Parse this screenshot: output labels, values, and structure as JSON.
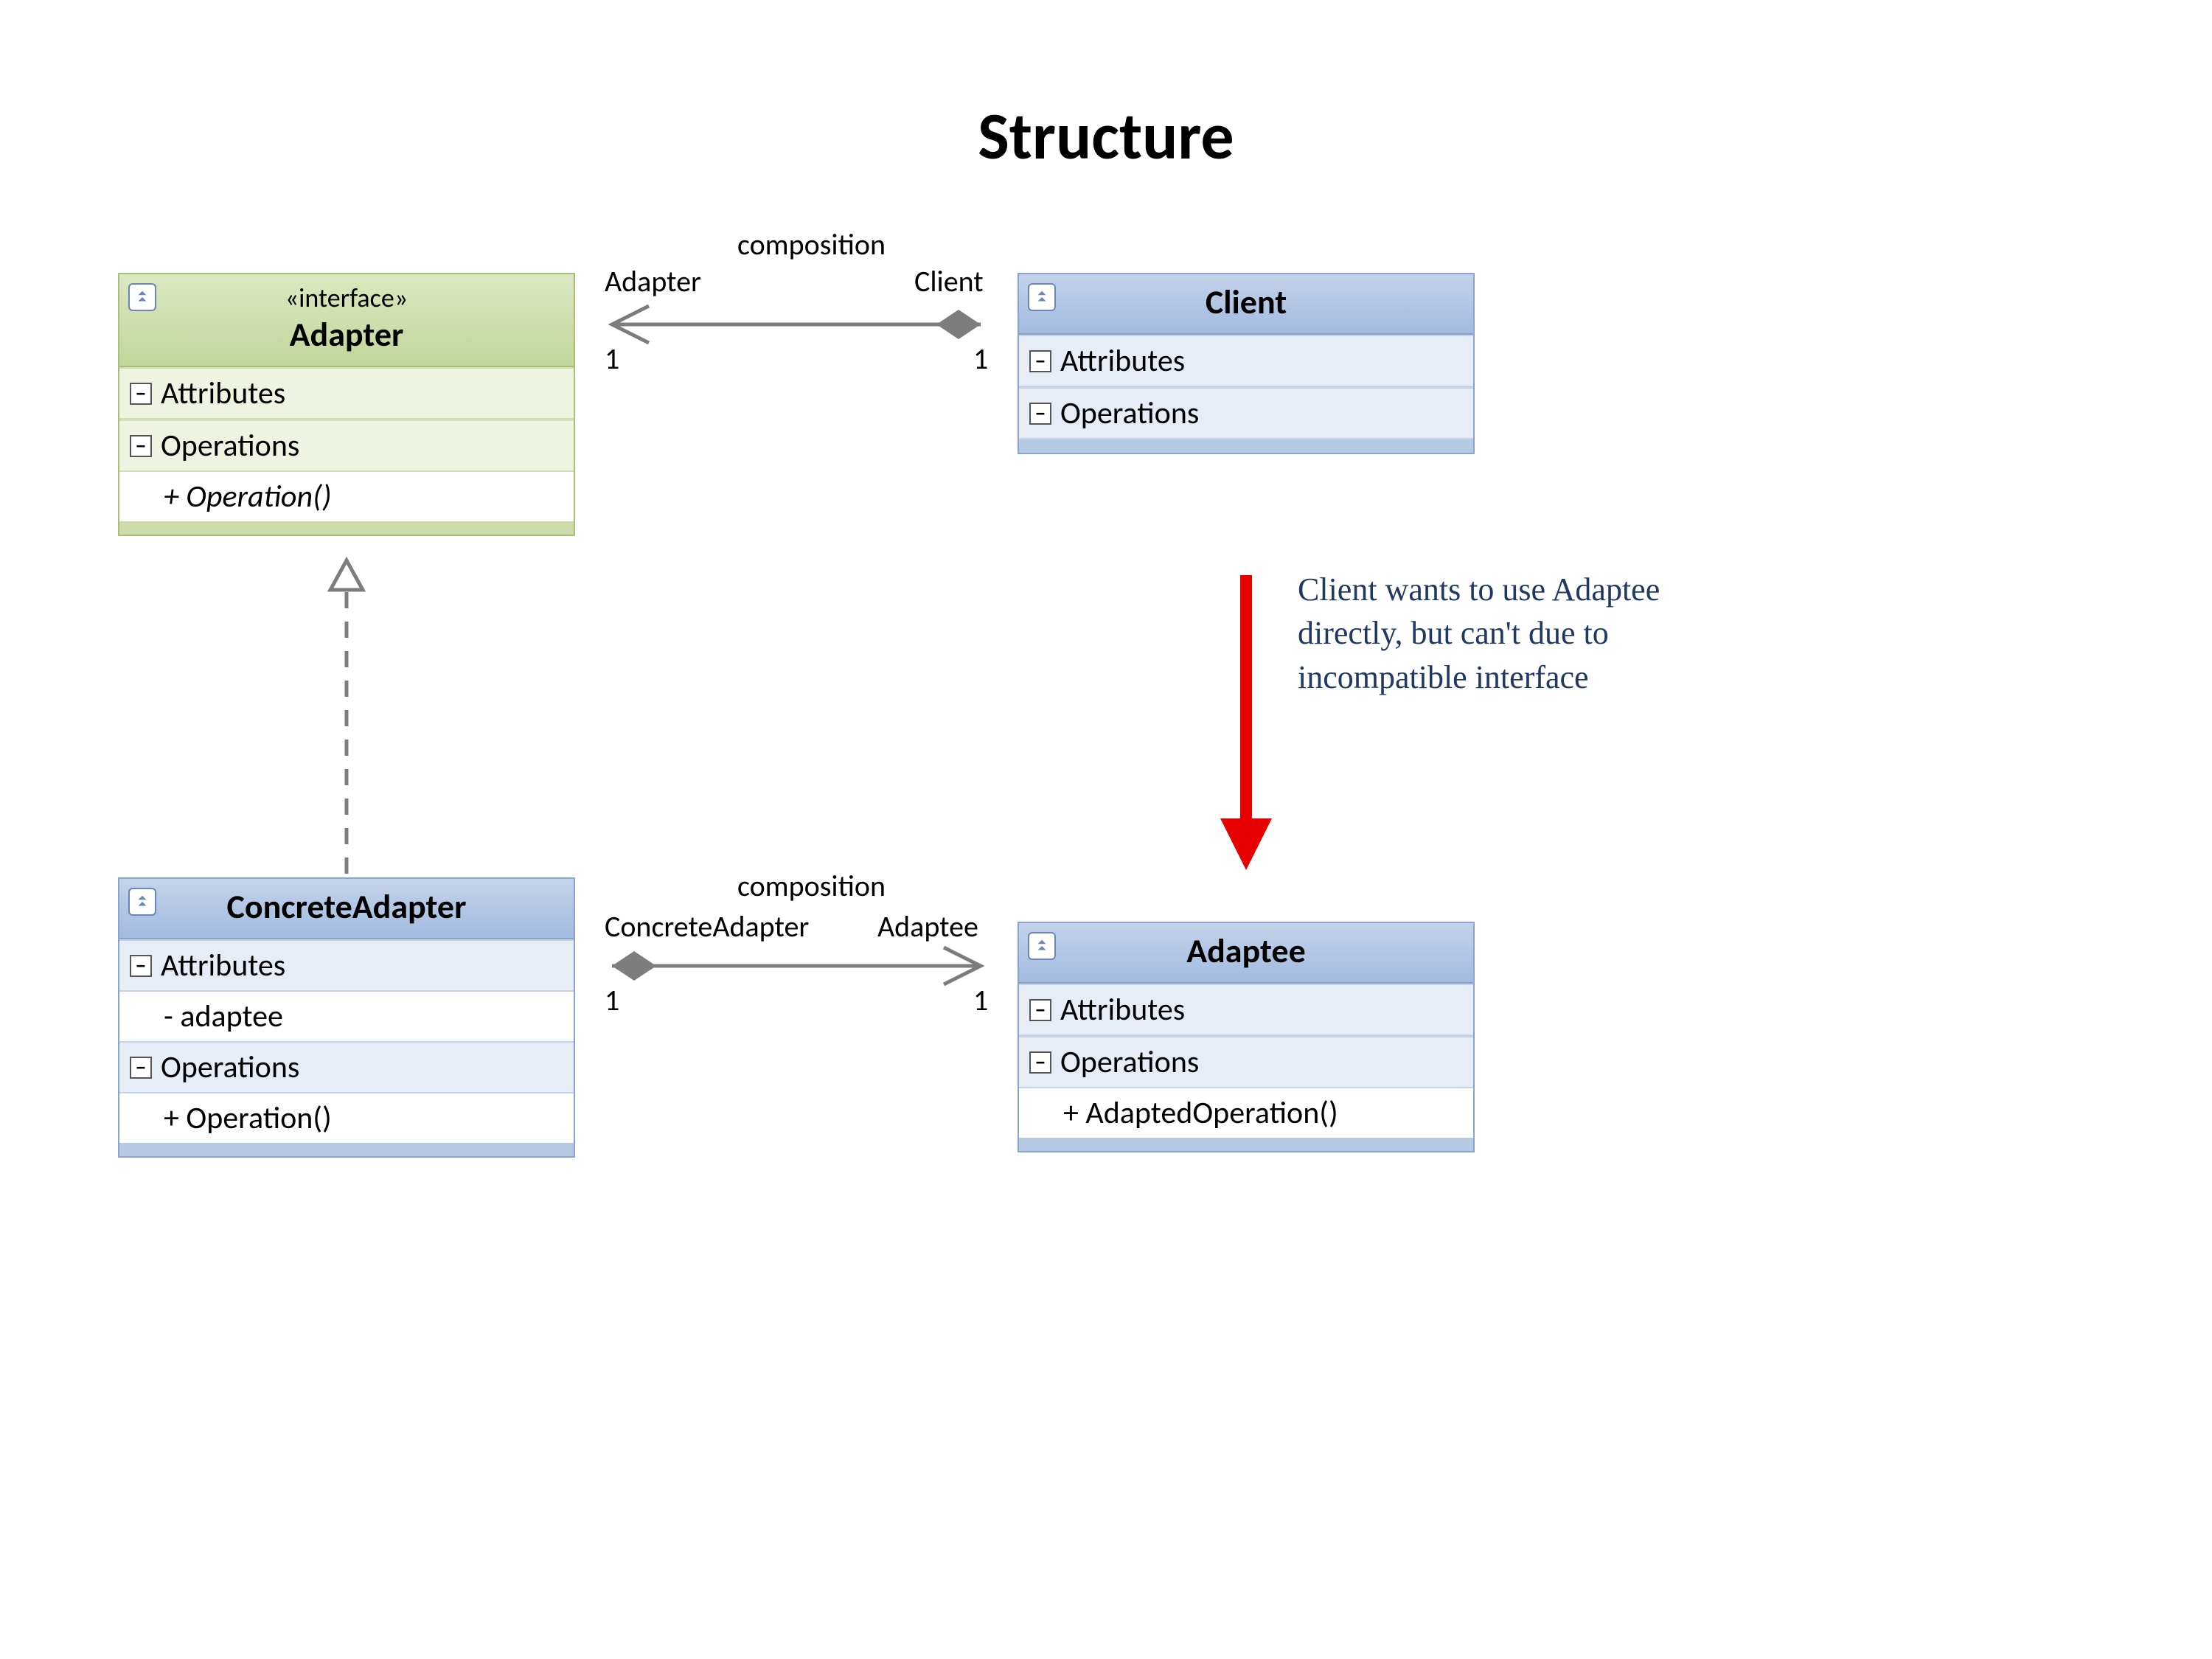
{
  "title": "Structure",
  "classes": {
    "adapter": {
      "stereotype": "«interface»",
      "name": "Adapter",
      "sections": {
        "attrs": {
          "label": "Attributes"
        },
        "ops": {
          "label": "Operations",
          "members": [
            "+ Operation()"
          ]
        }
      }
    },
    "client": {
      "name": "Client",
      "sections": {
        "attrs": {
          "label": "Attributes"
        },
        "ops": {
          "label": "Operations"
        }
      }
    },
    "concreteAdapter": {
      "name": "ConcreteAdapter",
      "sections": {
        "attrs": {
          "label": "Attributes",
          "members": [
            "- adaptee"
          ]
        },
        "ops": {
          "label": "Operations",
          "members": [
            "+ Operation()"
          ]
        }
      }
    },
    "adaptee": {
      "name": "Adaptee",
      "sections": {
        "attrs": {
          "label": "Attributes"
        },
        "ops": {
          "label": "Operations",
          "members": [
            "+ AdaptedOperation()"
          ]
        }
      }
    }
  },
  "connectors": {
    "c1": {
      "label": "composition",
      "end1": {
        "role": "Adapter",
        "mult": "1"
      },
      "end2": {
        "role": "Client",
        "mult": "1"
      }
    },
    "c2": {
      "label": "composition",
      "end1": {
        "role": "ConcreteAdapter",
        "mult": "1"
      },
      "end2": {
        "role": "Adaptee",
        "mult": "1"
      }
    }
  },
  "note": "Client wants to use Adaptee directly, but can't due to incompatible interface"
}
